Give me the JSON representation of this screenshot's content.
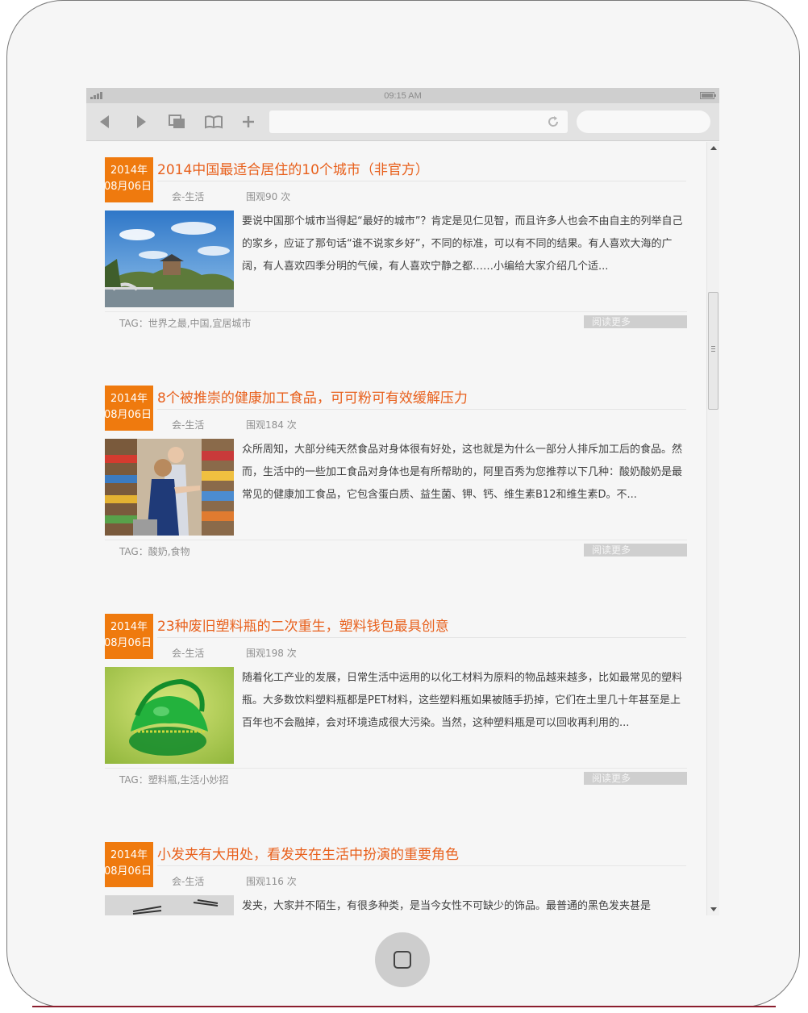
{
  "status_bar": {
    "time": "09:15 AM"
  },
  "articles": [
    {
      "date_year": "2014年",
      "date_day": "08月06日",
      "title": "2014中国最适合居住的10个城市（非官方）",
      "category": "会-生活",
      "views": "围观90 次",
      "excerpt": "要说中国那个城市当得起“最好的城市”？肯定是见仁见智，而且许多人也会不由自主的列举自己的家乡，应证了那句话“谁不说家乡好”，不同的标准，可以有不同的结果。有人喜欢大海的广阔，有人喜欢四季分明的气候，有人喜欢宁静之都……小编给大家介绍几个适...",
      "tags": "TAG：世界之最,中国,宜居城市",
      "read_more": "阅读更多"
    },
    {
      "date_year": "2014年",
      "date_day": "08月06日",
      "title": "8个被推崇的健康加工食品，可可粉可有效缓解压力",
      "category": "会-生活",
      "views": "围观184 次",
      "excerpt": "众所周知，大部分纯天然食品对身体很有好处，这也就是为什么一部分人排斥加工后的食品。然而，生活中的一些加工食品对身体也是有所帮助的，阿里百秀为您推荐以下几种：酸奶酸奶是最常见的健康加工食品，它包含蛋白质、益生菌、钾、钙、维生素B12和维生素D。不...",
      "tags": "TAG：酸奶,食物",
      "read_more": "阅读更多"
    },
    {
      "date_year": "2014年",
      "date_day": "08月06日",
      "title": "23种废旧塑料瓶的二次重生，塑料钱包最具创意",
      "category": "会-生活",
      "views": "围观198 次",
      "excerpt": "随着化工产业的发展，日常生活中运用的以化工材料为原料的物品越来越多，比如最常见的塑料瓶。大多数饮料塑料瓶都是PET材料，这些塑料瓶如果被随手扔掉，它们在土里几十年甚至是上百年也不会融掉，会对环境造成很大污染。当然，这种塑料瓶是可以回收再利用的...",
      "tags": "TAG：塑料瓶,生活小妙招",
      "read_more": "阅读更多"
    },
    {
      "date_year": "2014年",
      "date_day": "08月06日",
      "title": "小发夹有大用处，看发夹在生活中扮演的重要角色",
      "category": "会-生活",
      "views": "围观116 次",
      "excerpt": "发夹，大家并不陌生，有很多种类，是当今女性不可缺少的饰品。最普通的黑色发夹甚是",
      "tags": "",
      "read_more": ""
    }
  ],
  "colors": {
    "accent": "#ef7a0e",
    "title": "#e8601c",
    "read_more_bg": "#cfcfcf"
  },
  "icons": {
    "back": "back-arrow-icon",
    "forward": "forward-arrow-icon",
    "tabs": "tabs-icon",
    "bookmarks": "bookmarks-icon",
    "add": "plus-icon",
    "reload": "reload-icon",
    "home": "home-button-icon"
  }
}
